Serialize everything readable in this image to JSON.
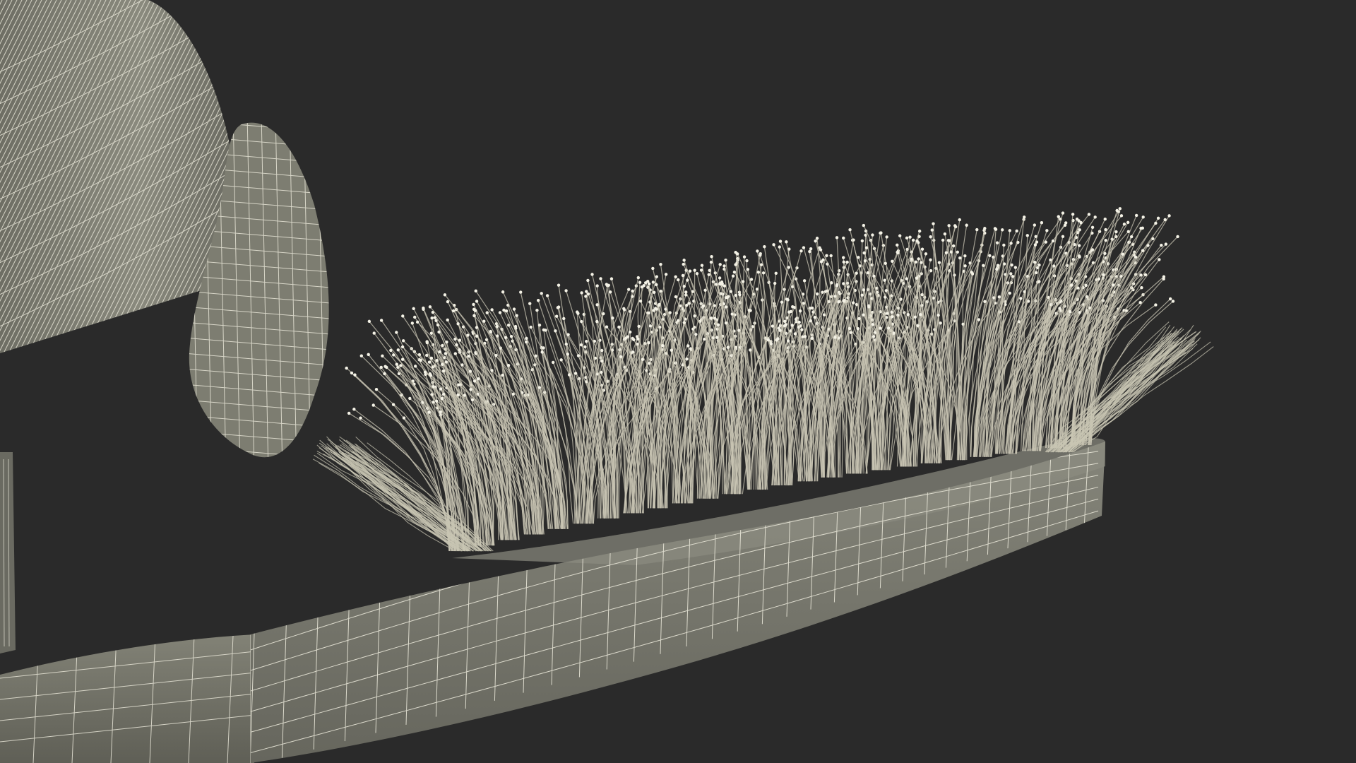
{
  "scene": {
    "background_color": "#2a2a2a",
    "surface_color": "#7b7b6f",
    "surface_shadow_color": "#5b5b52",
    "wire_color": "#e8e6d8",
    "bristle_color": "#c9c6b4",
    "bristle_tip_color": "#f4f2e6",
    "objects": [
      "electric-toothbrush-body",
      "toothbrush-bristles",
      "toothbrush-handle"
    ]
  }
}
